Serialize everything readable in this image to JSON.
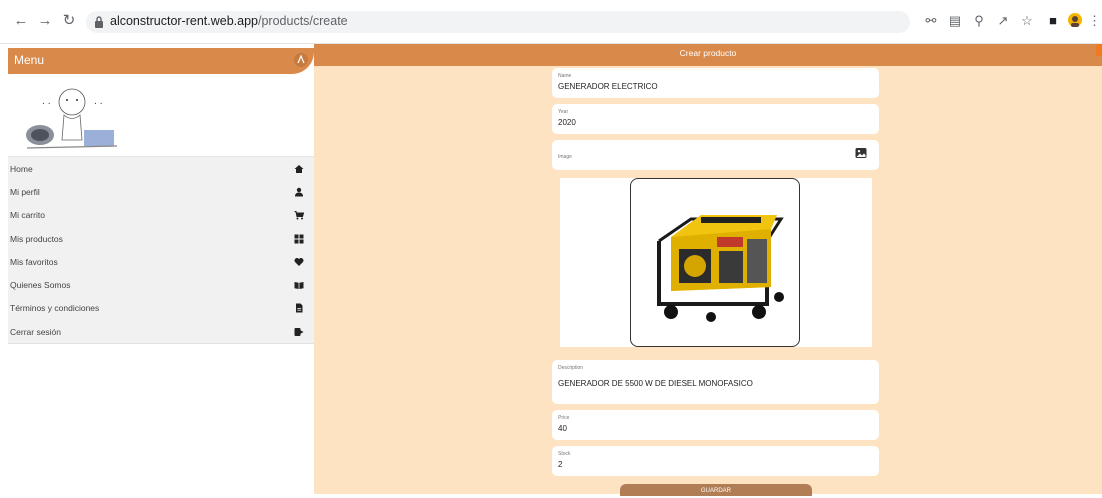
{
  "browser": {
    "url_domain": "alconstructor-rent.web.app",
    "url_path": "/products/create"
  },
  "sidebar": {
    "title": "Menu",
    "items": [
      {
        "label": "Home",
        "icon": "home-icon"
      },
      {
        "label": "Mi perfil",
        "icon": "user-icon"
      },
      {
        "label": "Mi carrito",
        "icon": "cart-icon"
      },
      {
        "label": "Mis productos",
        "icon": "grid-icon"
      },
      {
        "label": "Mis favoritos",
        "icon": "heart-icon"
      },
      {
        "label": "Quienes Somos",
        "icon": "book-icon"
      },
      {
        "label": "Términos y condiciones",
        "icon": "document-icon"
      },
      {
        "label": "Cerrar sesión",
        "icon": "logout-icon"
      }
    ]
  },
  "main": {
    "title": "Crear producto",
    "fields": {
      "name": {
        "label": "Name",
        "value": "GENERADOR ELECTRICO"
      },
      "year": {
        "label": "Year",
        "value": "2020"
      },
      "image": {
        "label": "Image"
      },
      "description": {
        "label": "Description",
        "value": "GENERADOR DE 5500 W DE DIESEL MONOFASICO"
      },
      "price": {
        "label": "Price",
        "value": "40"
      },
      "stock": {
        "label": "Stock",
        "value": "2"
      }
    },
    "save_label": "GUARDAR"
  },
  "colors": {
    "accent": "#d9894a",
    "page_background": "#fde3c2",
    "button": "#b07d55"
  }
}
